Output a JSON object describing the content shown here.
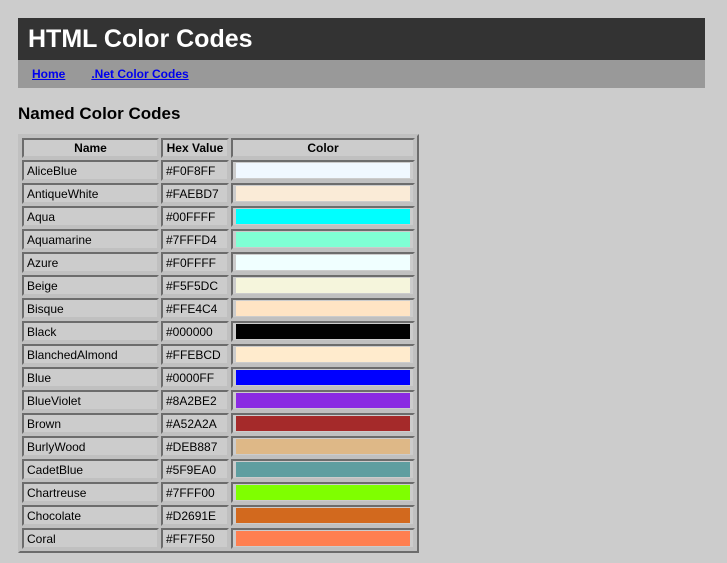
{
  "masthead": {
    "title": "HTML Color Codes"
  },
  "nav": {
    "links": [
      {
        "label": "Home"
      },
      {
        "label": ".Net Color Codes"
      }
    ]
  },
  "section": {
    "heading": "Named Color Codes"
  },
  "table": {
    "columns": [
      "Name",
      "Hex Value",
      "Color"
    ],
    "rows": [
      {
        "name": "AliceBlue",
        "hex": "#F0F8FF",
        "color": "#F0F8FF"
      },
      {
        "name": "AntiqueWhite",
        "hex": "#FAEBD7",
        "color": "#FAEBD7"
      },
      {
        "name": "Aqua",
        "hex": "#00FFFF",
        "color": "#00FFFF"
      },
      {
        "name": "Aquamarine",
        "hex": "#7FFFD4",
        "color": "#7FFFD4"
      },
      {
        "name": "Azure",
        "hex": "#F0FFFF",
        "color": "#F0FFFF"
      },
      {
        "name": "Beige",
        "hex": "#F5F5DC",
        "color": "#F5F5DC"
      },
      {
        "name": "Bisque",
        "hex": "#FFE4C4",
        "color": "#FFE4C4"
      },
      {
        "name": "Black",
        "hex": "#000000",
        "color": "#000000"
      },
      {
        "name": "BlanchedAlmond",
        "hex": "#FFEBCD",
        "color": "#FFEBCD"
      },
      {
        "name": "Blue",
        "hex": "#0000FF",
        "color": "#0000FF"
      },
      {
        "name": "BlueViolet",
        "hex": "#8A2BE2",
        "color": "#8A2BE2"
      },
      {
        "name": "Brown",
        "hex": "#A52A2A",
        "color": "#A52A2A"
      },
      {
        "name": "BurlyWood",
        "hex": "#DEB887",
        "color": "#DEB887"
      },
      {
        "name": "CadetBlue",
        "hex": "#5F9EA0",
        "color": "#5F9EA0"
      },
      {
        "name": "Chartreuse",
        "hex": "#7FFF00",
        "color": "#7FFF00"
      },
      {
        "name": "Chocolate",
        "hex": "#D2691E",
        "color": "#D2691E"
      },
      {
        "name": "Coral",
        "hex": "#FF7F50",
        "color": "#FF7F50"
      }
    ]
  },
  "theme": {
    "page_background": "#CCCCCC",
    "masthead_background": "#333333",
    "masthead_text": "#FFFFFF",
    "navbar_background": "#999999",
    "link_color": "#0000EE",
    "table_cell_background": "#CCCCCC",
    "table_border": "#C0C0C0"
  }
}
